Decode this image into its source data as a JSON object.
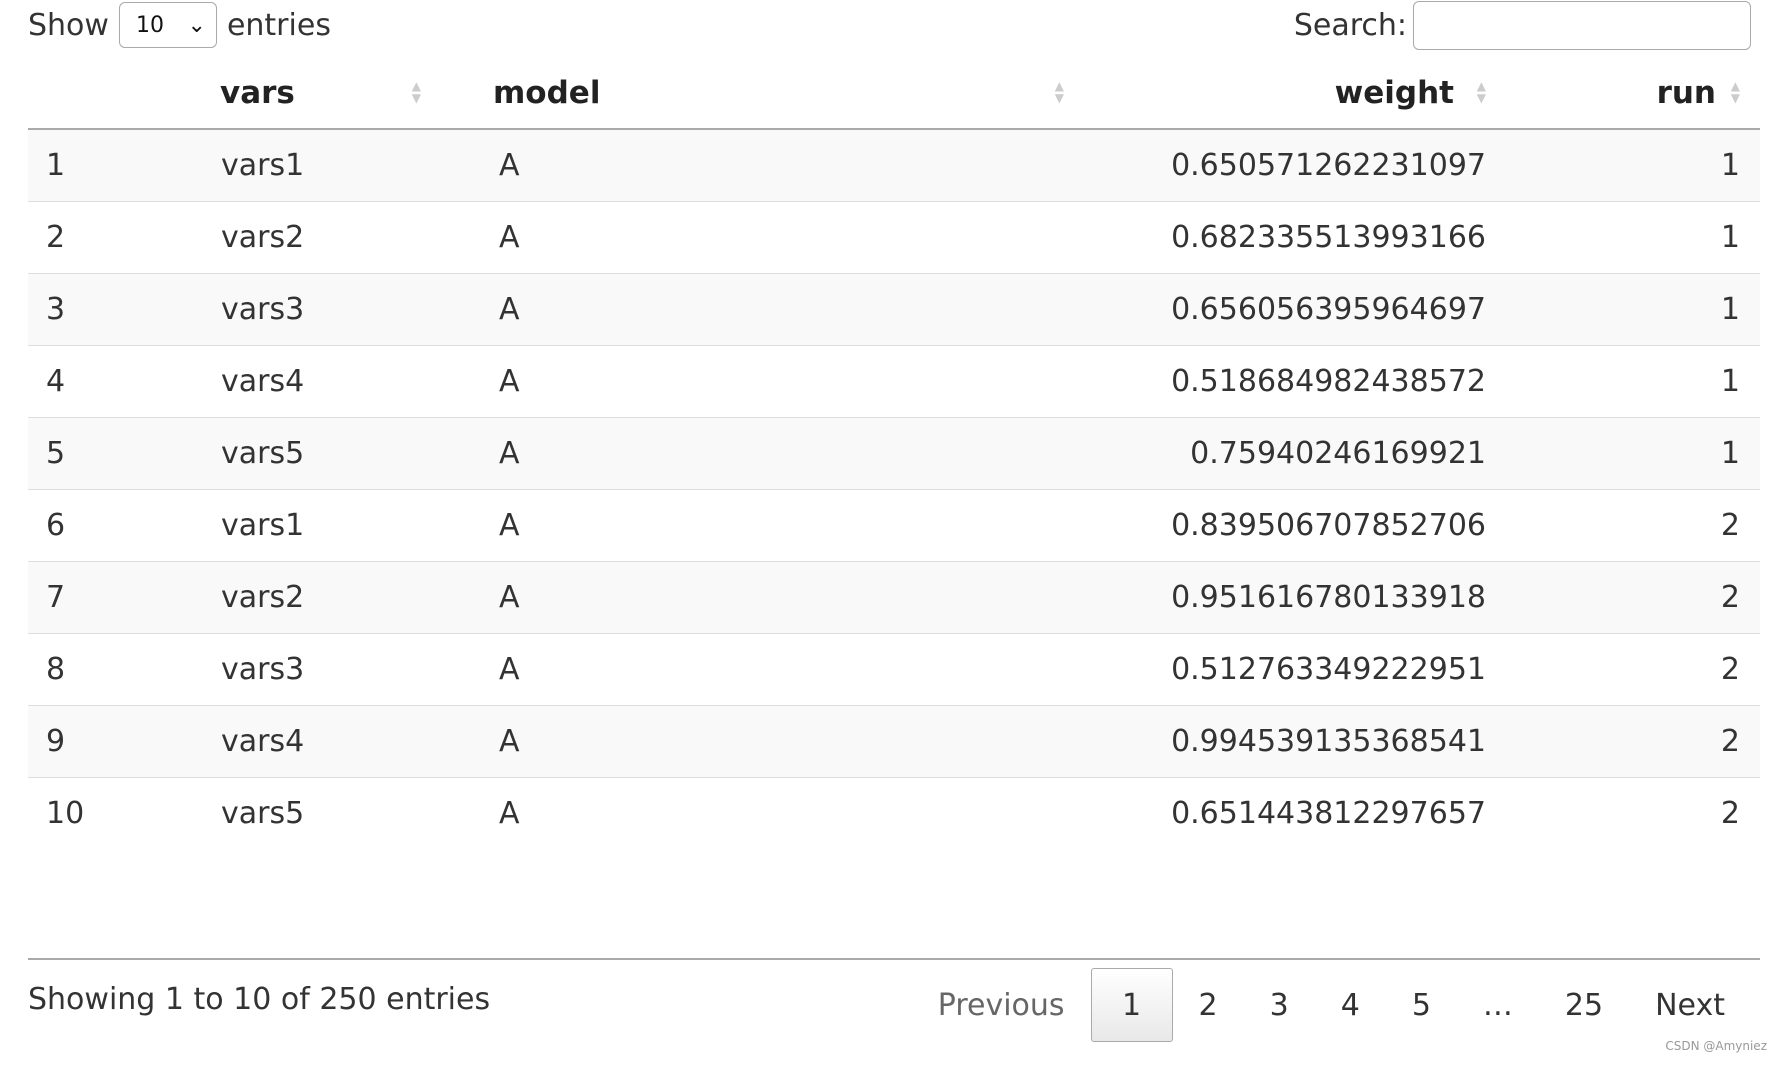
{
  "length_menu": {
    "prefix": "Show",
    "value": "10",
    "suffix": "entries"
  },
  "search": {
    "label": "Search:",
    "value": ""
  },
  "table": {
    "columns": [
      "",
      "vars",
      "model",
      "weight",
      "run"
    ],
    "rows": [
      [
        "1",
        "vars1",
        "A",
        "0.650571262231097",
        "1"
      ],
      [
        "2",
        "vars2",
        "A",
        "0.682335513993166",
        "1"
      ],
      [
        "3",
        "vars3",
        "A",
        "0.656056395964697",
        "1"
      ],
      [
        "4",
        "vars4",
        "A",
        "0.518684982438572",
        "1"
      ],
      [
        "5",
        "vars5",
        "A",
        "0.75940246169921",
        "1"
      ],
      [
        "6",
        "vars1",
        "A",
        "0.839506707852706",
        "2"
      ],
      [
        "7",
        "vars2",
        "A",
        "0.951616780133918",
        "2"
      ],
      [
        "8",
        "vars3",
        "A",
        "0.512763349222951",
        "2"
      ],
      [
        "9",
        "vars4",
        "A",
        "0.994539135368541",
        "2"
      ],
      [
        "10",
        "vars5",
        "A",
        "0.651443812297657",
        "2"
      ]
    ]
  },
  "info": "Showing 1 to 10 of 250 entries",
  "pagination": {
    "previous": "Previous",
    "pages": [
      "1",
      "2",
      "3",
      "4",
      "5",
      "…",
      "25"
    ],
    "current": "1",
    "next": "Next"
  },
  "watermark": "CSDN @Amyniez"
}
